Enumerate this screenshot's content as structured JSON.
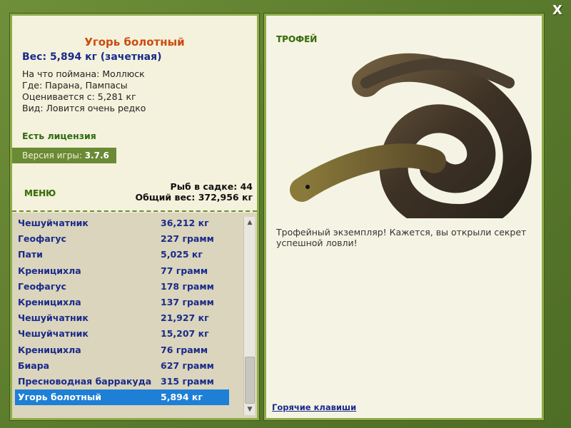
{
  "window": {
    "close_label": "X"
  },
  "fish": {
    "name": "Угорь болотный",
    "weight": "Вес: 5,894 кг (зачетная)",
    "bait": "На что поймана: Моллюск",
    "location": "Где: Парана, Пампасы",
    "rated_from": "Оценивается с: 5,281 кг",
    "rarity": "Вид: Ловится очень редко"
  },
  "license": "Есть лицензия",
  "version": {
    "label": "Версия игры:",
    "value": "3.7.6"
  },
  "menu_label": "МЕНЮ",
  "cage": {
    "count": "Рыб в садке: 44",
    "total": "Общий вес: 372,956 кг"
  },
  "catch_list": [
    {
      "name": "Чешуйчатник",
      "weight": "36,212 кг"
    },
    {
      "name": "Геофагус",
      "weight": "227 грамм"
    },
    {
      "name": "Пати",
      "weight": "5,025 кг"
    },
    {
      "name": "Креницихла",
      "weight": "77 грамм"
    },
    {
      "name": "Геофагус",
      "weight": "178 грамм"
    },
    {
      "name": "Креницихла",
      "weight": "137 грамм"
    },
    {
      "name": "Чешуйчатник",
      "weight": "21,927 кг"
    },
    {
      "name": "Чешуйчатник",
      "weight": "15,207 кг"
    },
    {
      "name": "Креницихла",
      "weight": "76 грамм"
    },
    {
      "name": "Биара",
      "weight": "627 грамм"
    },
    {
      "name": "Пресноводная барракуда",
      "weight": "315 грамм"
    },
    {
      "name": "Угорь болотный",
      "weight": "5,894 кг",
      "selected": true
    }
  ],
  "trophy": {
    "label": "ТРОФЕЙ",
    "text": "Трофейный экземпляр! Кажется, вы открыли секрет успешной ловли!"
  },
  "hotkeys_label": "Горячие клавиши",
  "colors": {
    "frame": "#5b7a2e",
    "panel": "#f4f2dc",
    "selected": "#1e7fd6",
    "title": "#cc4a0f",
    "link": "#1a2a8a"
  }
}
